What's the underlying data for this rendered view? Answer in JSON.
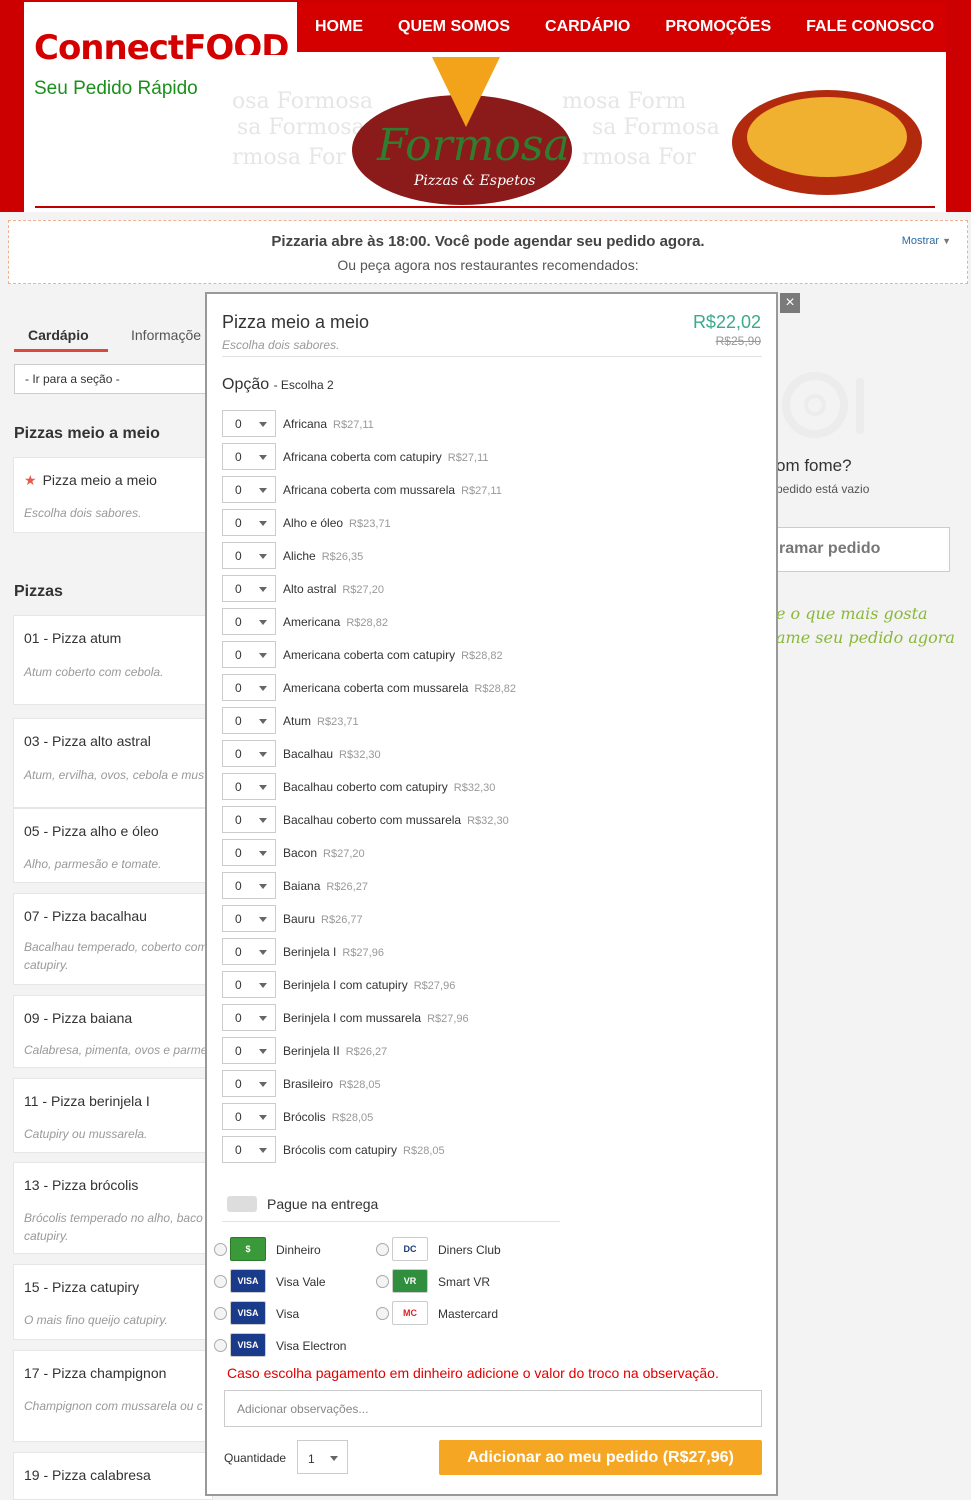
{
  "brand": {
    "logo": "ConnectFOOD",
    "tagline": "Seu Pedido Rápido"
  },
  "nav": [
    "HOME",
    "QUEM SOMOS",
    "CARDÁPIO",
    "PROMOÇÕES",
    "FALE CONOSCO"
  ],
  "banner": {
    "name": "Formosa",
    "subtitle": "Pizzas & Espetos"
  },
  "notice": {
    "title": "Pizzaria abre às 18:00. Você pode agendar seu pedido agora.",
    "subtitle": "Ou peça agora nos restaurantes recomendados:",
    "toggle": "Mostrar"
  },
  "menu": {
    "tabs": [
      "Cardápio",
      "Informaçõe"
    ],
    "section_select": "- Ir para a seção -",
    "sections": [
      {
        "title": "Pizzas meio a meio",
        "items": [
          {
            "name": "Pizza meio a meio",
            "desc": "Escolha dois sabores."
          }
        ]
      },
      {
        "title": "Pizzas",
        "items": [
          {
            "name": "01 - Pizza atum",
            "desc": "Atum coberto com cebola."
          },
          {
            "name": "03 - Pizza alto astral",
            "desc": "Atum, ervilha, ovos, cebola e mus"
          },
          {
            "name": "05 - Pizza alho e óleo",
            "desc": "Alho, parmesão e tomate."
          },
          {
            "name": "07 - Pizza bacalhau",
            "desc": "Bacalhau temperado, coberto com catupiry."
          },
          {
            "name": "09 - Pizza baiana",
            "desc": "Calabresa, pimenta, ovos e parme"
          },
          {
            "name": "11 - Pizza berinjela I",
            "desc": "Catupiry ou mussarela."
          },
          {
            "name": "13 - Pizza brócolis",
            "desc": "Brócolis temperado no alho, baco catupiry."
          },
          {
            "name": "15 - Pizza catupiry",
            "desc": "O mais fino queijo catupiry."
          },
          {
            "name": "17 - Pizza champignon",
            "desc": "Champignon com mussarela ou c"
          },
          {
            "name": "19 - Pizza calabresa",
            "desc": ""
          }
        ]
      }
    ]
  },
  "cart": {
    "hungry": "om fome?",
    "empty": "pedido está vazio",
    "confirm": "ramar pedido",
    "promo_line1": "e o que mais gosta",
    "promo_line2": "ame seu pedido agora"
  },
  "modal": {
    "close": "×",
    "title": "Pizza meio a meio",
    "subtitle": "Escolha dois sabores.",
    "price": "R$22,02",
    "old_price": "R$25,90",
    "option_label": "Opção",
    "option_hint": "- Escolha 2",
    "flavors": [
      {
        "qty": "0",
        "name": "Africana",
        "price": "R$27,11"
      },
      {
        "qty": "0",
        "name": "Africana coberta com catupiry",
        "price": "R$27,11"
      },
      {
        "qty": "0",
        "name": "Africana coberta com mussarela",
        "price": "R$27,11"
      },
      {
        "qty": "0",
        "name": "Alho e óleo",
        "price": "R$23,71"
      },
      {
        "qty": "0",
        "name": "Aliche",
        "price": "R$26,35"
      },
      {
        "qty": "0",
        "name": "Alto astral",
        "price": "R$27,20"
      },
      {
        "qty": "0",
        "name": "Americana",
        "price": "R$28,82"
      },
      {
        "qty": "0",
        "name": "Americana coberta com catupiry",
        "price": "R$28,82"
      },
      {
        "qty": "0",
        "name": "Americana coberta com mussarela",
        "price": "R$28,82"
      },
      {
        "qty": "0",
        "name": "Atum",
        "price": "R$23,71"
      },
      {
        "qty": "0",
        "name": "Bacalhau",
        "price": "R$32,30"
      },
      {
        "qty": "0",
        "name": "Bacalhau coberto com catupiry",
        "price": "R$32,30"
      },
      {
        "qty": "0",
        "name": "Bacalhau coberto com mussarela",
        "price": "R$32,30"
      },
      {
        "qty": "0",
        "name": "Bacon",
        "price": "R$27,20"
      },
      {
        "qty": "0",
        "name": "Baiana",
        "price": "R$26,27"
      },
      {
        "qty": "0",
        "name": "Bauru",
        "price": "R$26,77"
      },
      {
        "qty": "0",
        "name": "Berinjela I",
        "price": "R$27,96"
      },
      {
        "qty": "0",
        "name": "Berinjela I com catupiry",
        "price": "R$27,96"
      },
      {
        "qty": "0",
        "name": "Berinjela I com mussarela",
        "price": "R$27,96"
      },
      {
        "qty": "0",
        "name": "Berinjela II",
        "price": "R$26,27"
      },
      {
        "qty": "0",
        "name": "Brasileiro",
        "price": "R$28,05"
      },
      {
        "qty": "0",
        "name": "Brócolis",
        "price": "R$28,05"
      },
      {
        "qty": "0",
        "name": "Brócolis com catupiry",
        "price": "R$28,05"
      }
    ],
    "payment_title": "Pague na entrega",
    "payments": [
      {
        "label": "Dinheiro",
        "icon": "cash-icon"
      },
      {
        "label": "Diners Club",
        "icon": "diners-club-icon"
      },
      {
        "label": "Visa Vale",
        "icon": "visa-icon"
      },
      {
        "label": "Smart VR",
        "icon": "vr-icon"
      },
      {
        "label": "Visa",
        "icon": "visa-icon"
      },
      {
        "label": "Mastercard",
        "icon": "mastercard-icon"
      },
      {
        "label": "Visa Electron",
        "icon": "visa-icon"
      }
    ],
    "cash_warning": "Caso escolha pagamento em dinheiro adicione o valor do troco na observação.",
    "notes_placeholder": "Adicionar observações...",
    "quantity_label": "Quantidade",
    "quantity_value": "1",
    "add_button": "Adicionar ao meu pedido (R$27,96)"
  },
  "colors": {
    "brand_red": "#cc0000",
    "accent_orange": "#f5a623",
    "price_green": "#3aaa8a",
    "logo_green": "#1a8f1a"
  }
}
